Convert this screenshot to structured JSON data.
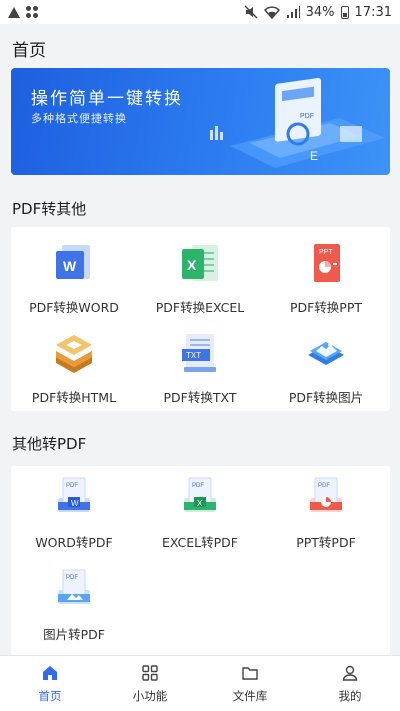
{
  "status_bar": {
    "battery": "34%",
    "time": "17:31"
  },
  "header": {
    "title": "首页"
  },
  "banner": {
    "title": "操作简单一键转换",
    "subtitle": "多种格式便捷转换",
    "art_labels": {
      "pdf": "PDF",
      "w": "W",
      "e": "E"
    }
  },
  "pdf_to_other": {
    "title": "PDF转其他",
    "items": [
      {
        "label": "PDF转换WORD",
        "icon": "word-doc-icon"
      },
      {
        "label": "PDF转换EXCEL",
        "icon": "excel-doc-icon"
      },
      {
        "label": "PDF转换PPT",
        "icon": "ppt-doc-icon"
      },
      {
        "label": "PDF转换HTML",
        "icon": "html-doc-icon"
      },
      {
        "label": "PDF转换TXT",
        "icon": "txt-doc-icon"
      },
      {
        "label": "PDF转换图片",
        "icon": "image-doc-icon"
      }
    ]
  },
  "other_to_pdf": {
    "title": "其他转PDF",
    "items": [
      {
        "label": "WORD转PDF",
        "icon": "word-to-pdf-icon"
      },
      {
        "label": "EXCEL转PDF",
        "icon": "excel-to-pdf-icon"
      },
      {
        "label": "PPT转PDF",
        "icon": "ppt-to-pdf-icon"
      },
      {
        "label": "图片转PDF",
        "icon": "image-to-pdf-icon"
      }
    ]
  },
  "icon_text": {
    "word": "W",
    "excel": "X",
    "ppt": "PPT",
    "txt": "TXT",
    "pdf": "PDF"
  },
  "bottom_nav": [
    {
      "label": "首页",
      "icon": "home-icon",
      "active": true
    },
    {
      "label": "小功能",
      "icon": "grid-icon",
      "active": false
    },
    {
      "label": "文件库",
      "icon": "folder-icon",
      "active": false
    },
    {
      "label": "我的",
      "icon": "user-icon",
      "active": false
    }
  ],
  "colors": {
    "accent": "#2f6bf0",
    "banner_start": "#1d5fe0",
    "word_blue": "#3f73e6",
    "excel_green": "#2db36b",
    "ppt_red": "#ef5a4c",
    "html_orange": "#f0a43a",
    "background": "#f2f3f5"
  }
}
